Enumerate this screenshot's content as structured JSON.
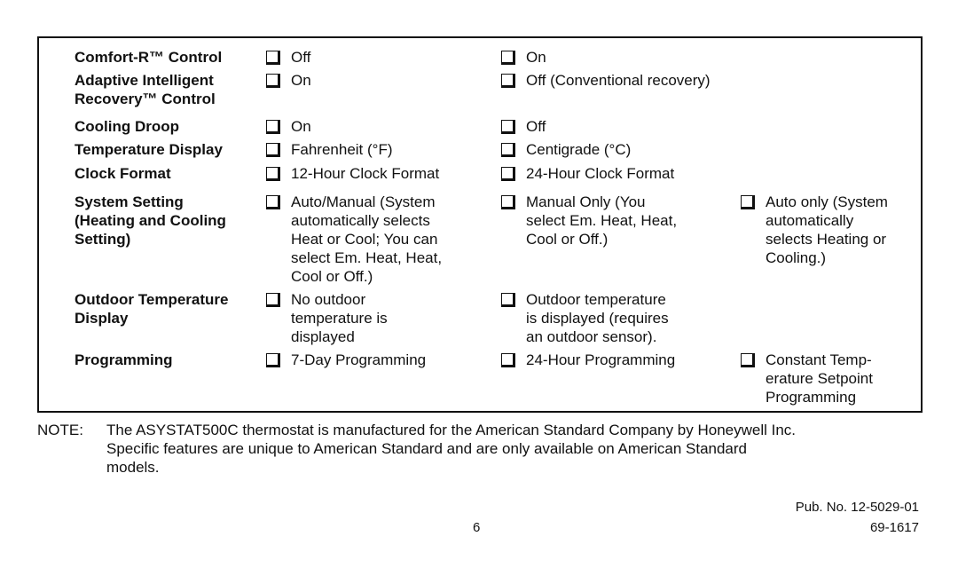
{
  "settings_table": {
    "rows": [
      {
        "label": "Comfort-R™ Control",
        "options": [
          "Off",
          "On"
        ]
      },
      {
        "label": "Adaptive Intelligent\nRecovery™ Control",
        "options": [
          "On",
          "Off (Conventional recovery)"
        ]
      },
      {
        "label": "Cooling Droop",
        "options": [
          "On",
          "Off"
        ]
      },
      {
        "label": "Temperature Display",
        "options": [
          "Fahrenheit (°F)",
          "Centigrade (°C)"
        ]
      },
      {
        "label": "Clock Format",
        "options": [
          "12-Hour Clock Format",
          "24-Hour Clock Format"
        ]
      },
      {
        "label": "System Setting\n(Heating and Cooling\nSetting)",
        "options": [
          "Auto/Manual (System\nautomatically selects\nHeat or Cool; You can\nselect Em. Heat, Heat,\nCool or Off.)",
          "Manual Only (You\nselect Em. Heat, Heat,\nCool or Off.)",
          "Auto only (System\nautomatically\nselects Heating or\nCooling.)"
        ]
      },
      {
        "label": "Outdoor Temperature\nDisplay",
        "options": [
          "No outdoor\ntemperature is\ndisplayed",
          "Outdoor temperature\nis displayed (requires\nan outdoor sensor)."
        ]
      },
      {
        "label": "Programming",
        "options": [
          "7-Day Programming",
          "24-Hour Programming",
          "Constant Temp-\nerature Setpoint\nProgramming"
        ]
      }
    ]
  },
  "note": {
    "tag": "NOTE:",
    "text": "The ASYSTAT500C thermostat is manufactured for the American Standard Company by Honeywell Inc.\nSpecific features are unique to American Standard and are only available on American Standard\nmodels."
  },
  "footer": {
    "pub_no": "Pub. No. 12-5029-01",
    "page_number": "6",
    "doc_number": "69-1617"
  }
}
